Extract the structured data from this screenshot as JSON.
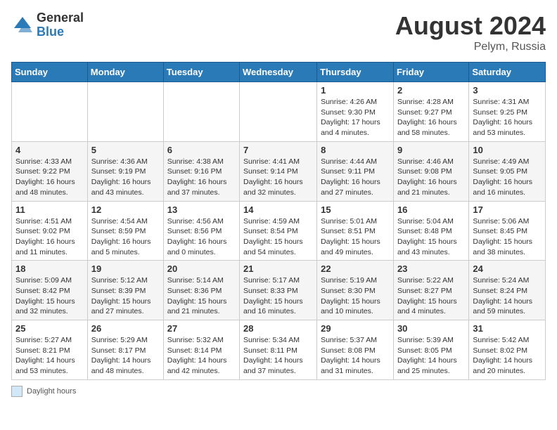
{
  "header": {
    "logo_general": "General",
    "logo_blue": "Blue",
    "month_year": "August 2024",
    "location": "Pelym, Russia"
  },
  "legend": {
    "label": "Daylight hours"
  },
  "days_of_week": [
    "Sunday",
    "Monday",
    "Tuesday",
    "Wednesday",
    "Thursday",
    "Friday",
    "Saturday"
  ],
  "weeks": [
    [
      {
        "day": "",
        "detail": ""
      },
      {
        "day": "",
        "detail": ""
      },
      {
        "day": "",
        "detail": ""
      },
      {
        "day": "",
        "detail": ""
      },
      {
        "day": "1",
        "detail": "Sunrise: 4:26 AM\nSunset: 9:30 PM\nDaylight: 17 hours and 4 minutes."
      },
      {
        "day": "2",
        "detail": "Sunrise: 4:28 AM\nSunset: 9:27 PM\nDaylight: 16 hours and 58 minutes."
      },
      {
        "day": "3",
        "detail": "Sunrise: 4:31 AM\nSunset: 9:25 PM\nDaylight: 16 hours and 53 minutes."
      }
    ],
    [
      {
        "day": "4",
        "detail": "Sunrise: 4:33 AM\nSunset: 9:22 PM\nDaylight: 16 hours and 48 minutes."
      },
      {
        "day": "5",
        "detail": "Sunrise: 4:36 AM\nSunset: 9:19 PM\nDaylight: 16 hours and 43 minutes."
      },
      {
        "day": "6",
        "detail": "Sunrise: 4:38 AM\nSunset: 9:16 PM\nDaylight: 16 hours and 37 minutes."
      },
      {
        "day": "7",
        "detail": "Sunrise: 4:41 AM\nSunset: 9:14 PM\nDaylight: 16 hours and 32 minutes."
      },
      {
        "day": "8",
        "detail": "Sunrise: 4:44 AM\nSunset: 9:11 PM\nDaylight: 16 hours and 27 minutes."
      },
      {
        "day": "9",
        "detail": "Sunrise: 4:46 AM\nSunset: 9:08 PM\nDaylight: 16 hours and 21 minutes."
      },
      {
        "day": "10",
        "detail": "Sunrise: 4:49 AM\nSunset: 9:05 PM\nDaylight: 16 hours and 16 minutes."
      }
    ],
    [
      {
        "day": "11",
        "detail": "Sunrise: 4:51 AM\nSunset: 9:02 PM\nDaylight: 16 hours and 11 minutes."
      },
      {
        "day": "12",
        "detail": "Sunrise: 4:54 AM\nSunset: 8:59 PM\nDaylight: 16 hours and 5 minutes."
      },
      {
        "day": "13",
        "detail": "Sunrise: 4:56 AM\nSunset: 8:56 PM\nDaylight: 16 hours and 0 minutes."
      },
      {
        "day": "14",
        "detail": "Sunrise: 4:59 AM\nSunset: 8:54 PM\nDaylight: 15 hours and 54 minutes."
      },
      {
        "day": "15",
        "detail": "Sunrise: 5:01 AM\nSunset: 8:51 PM\nDaylight: 15 hours and 49 minutes."
      },
      {
        "day": "16",
        "detail": "Sunrise: 5:04 AM\nSunset: 8:48 PM\nDaylight: 15 hours and 43 minutes."
      },
      {
        "day": "17",
        "detail": "Sunrise: 5:06 AM\nSunset: 8:45 PM\nDaylight: 15 hours and 38 minutes."
      }
    ],
    [
      {
        "day": "18",
        "detail": "Sunrise: 5:09 AM\nSunset: 8:42 PM\nDaylight: 15 hours and 32 minutes."
      },
      {
        "day": "19",
        "detail": "Sunrise: 5:12 AM\nSunset: 8:39 PM\nDaylight: 15 hours and 27 minutes."
      },
      {
        "day": "20",
        "detail": "Sunrise: 5:14 AM\nSunset: 8:36 PM\nDaylight: 15 hours and 21 minutes."
      },
      {
        "day": "21",
        "detail": "Sunrise: 5:17 AM\nSunset: 8:33 PM\nDaylight: 15 hours and 16 minutes."
      },
      {
        "day": "22",
        "detail": "Sunrise: 5:19 AM\nSunset: 8:30 PM\nDaylight: 15 hours and 10 minutes."
      },
      {
        "day": "23",
        "detail": "Sunrise: 5:22 AM\nSunset: 8:27 PM\nDaylight: 15 hours and 4 minutes."
      },
      {
        "day": "24",
        "detail": "Sunrise: 5:24 AM\nSunset: 8:24 PM\nDaylight: 14 hours and 59 minutes."
      }
    ],
    [
      {
        "day": "25",
        "detail": "Sunrise: 5:27 AM\nSunset: 8:21 PM\nDaylight: 14 hours and 53 minutes."
      },
      {
        "day": "26",
        "detail": "Sunrise: 5:29 AM\nSunset: 8:17 PM\nDaylight: 14 hours and 48 minutes."
      },
      {
        "day": "27",
        "detail": "Sunrise: 5:32 AM\nSunset: 8:14 PM\nDaylight: 14 hours and 42 minutes."
      },
      {
        "day": "28",
        "detail": "Sunrise: 5:34 AM\nSunset: 8:11 PM\nDaylight: 14 hours and 37 minutes."
      },
      {
        "day": "29",
        "detail": "Sunrise: 5:37 AM\nSunset: 8:08 PM\nDaylight: 14 hours and 31 minutes."
      },
      {
        "day": "30",
        "detail": "Sunrise: 5:39 AM\nSunset: 8:05 PM\nDaylight: 14 hours and 25 minutes."
      },
      {
        "day": "31",
        "detail": "Sunrise: 5:42 AM\nSunset: 8:02 PM\nDaylight: 14 hours and 20 minutes."
      }
    ]
  ]
}
